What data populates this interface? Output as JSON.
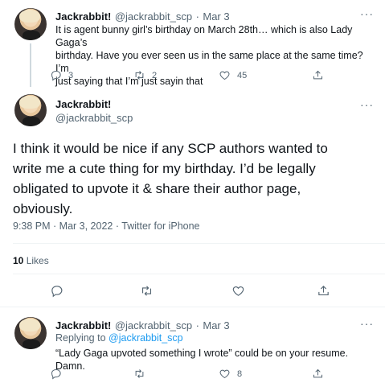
{
  "tweet1": {
    "name": "Jackrabbit!",
    "handle": "@jackrabbit_scp",
    "dot": "·",
    "date": "Mar 3",
    "more": "···",
    "text_line1": "It is agent bunny girl’s birthday on March 28th… which is also Lady Gaga’s",
    "text_line2": "birthday. Have you ever seen us in the same place at the same time? I’m",
    "text_line3": "just saying that I’m just sayin that",
    "replies": "3",
    "retweets": "2",
    "likes": "45"
  },
  "tweet2": {
    "name": "Jackrabbit!",
    "handle": "@jackrabbit_scp",
    "more": "···",
    "text_line1": "I think it would be nice if any SCP authors wanted to",
    "text_line2": "write me a cute thing for my birthday. I’d be legally",
    "text_line3": "obligated to upvote it & share their author page,",
    "text_line4": "obviously.",
    "timestamp": "9:38 PM · Mar 3, 2022 · Twitter for iPhone",
    "like_count": "10",
    "like_label": "Likes"
  },
  "tweet3": {
    "name": "Jackrabbit!",
    "handle": "@jackrabbit_scp",
    "dot": "·",
    "date": "Mar 3",
    "more": "···",
    "replying_prefix": "Replying to",
    "replying_handle": "@jackrabbit_scp",
    "text": "“Lady Gaga upvoted something I wrote” could be on your resume. Damn.",
    "likes": "8"
  },
  "icons": [
    "reply-icon",
    "retweet-icon",
    "like-icon",
    "share-icon",
    "more-icon"
  ]
}
